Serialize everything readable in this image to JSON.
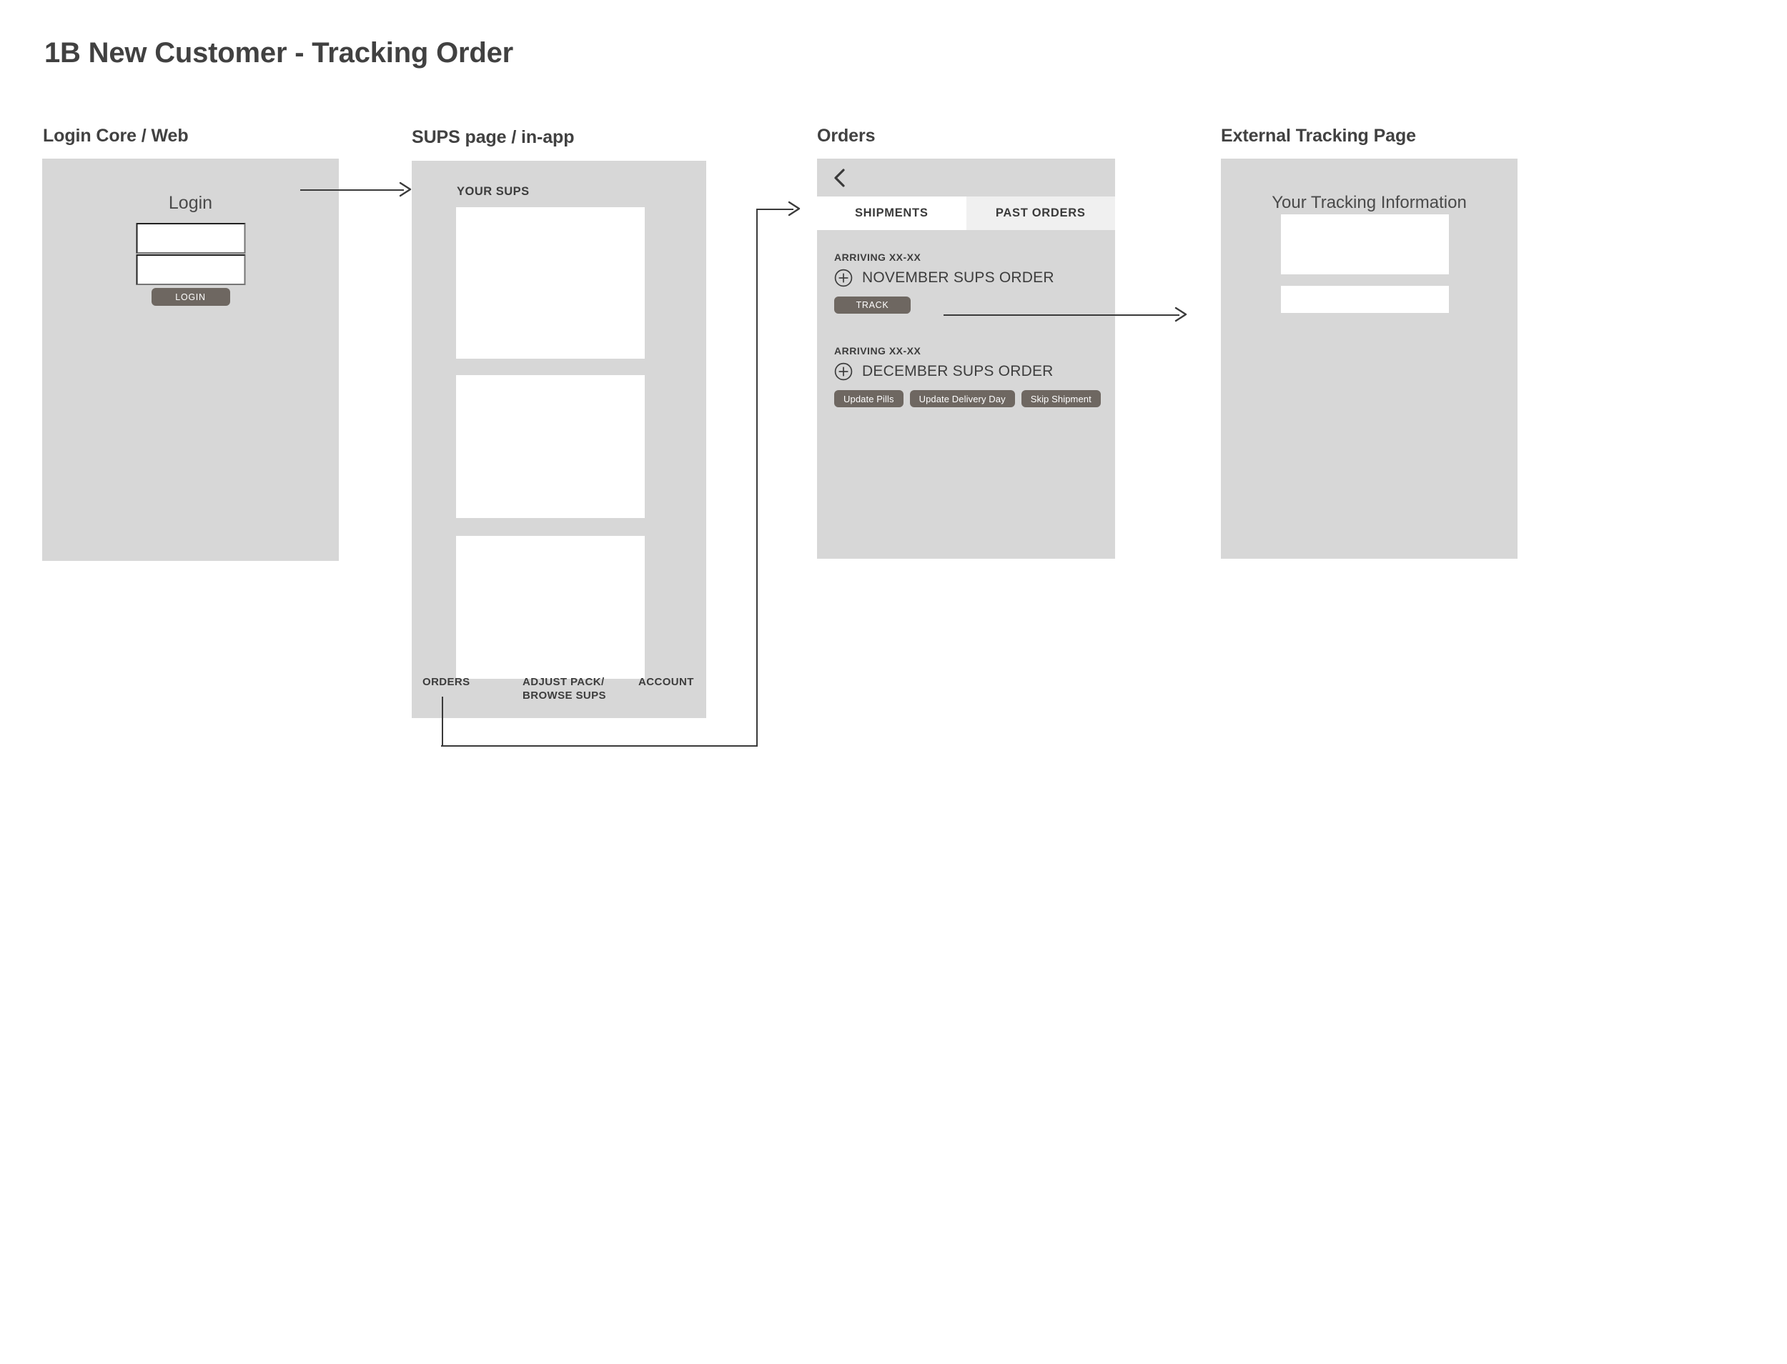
{
  "page": {
    "title": "1B New Customer - Tracking Order"
  },
  "sections": {
    "login": "Login Core / Web",
    "sups": "SUPS page / in-app",
    "orders": "Orders",
    "external": "External Tracking Page"
  },
  "login_screen": {
    "heading": "Login",
    "field_username_value": "",
    "field_password_value": "",
    "submit_label": "LOGIN"
  },
  "sups_screen": {
    "heading": "YOUR SUPS",
    "cards": [
      "",
      "",
      ""
    ],
    "nav": [
      {
        "label": "ORDERS"
      },
      {
        "label": "ADJUST PACK/\nBROWSE SUPS"
      },
      {
        "label": "ACCOUNT"
      }
    ]
  },
  "orders_screen": {
    "back_icon": "chevron-left-icon",
    "tabs": [
      {
        "label": "SHIPMENTS",
        "active": true
      },
      {
        "label": "PAST ORDERS",
        "active": false
      }
    ],
    "groups": [
      {
        "arriving": "ARRIVING XX-XX",
        "expand_icon": "plus-circle-icon",
        "name": "NOVEMBER SUPS ORDER",
        "actions": [
          "TRACK"
        ]
      },
      {
        "arriving": "ARRIVING XX-XX",
        "expand_icon": "plus-circle-icon",
        "name": "DECEMBER SUPS ORDER",
        "actions": [
          "Update Pills",
          "Update Delivery Day",
          "Skip Shipment"
        ]
      }
    ]
  },
  "external_screen": {
    "heading": "Your Tracking Information",
    "boxes": [
      "",
      ""
    ]
  },
  "colors": {
    "panel_background": "#d7d7d7",
    "button_fill": "#6e6761",
    "text_dark": "#3d3d3d",
    "tab_active": "#ffffff",
    "tab_inactive": "#f0f0f0",
    "connector": "#3a3a3a"
  }
}
